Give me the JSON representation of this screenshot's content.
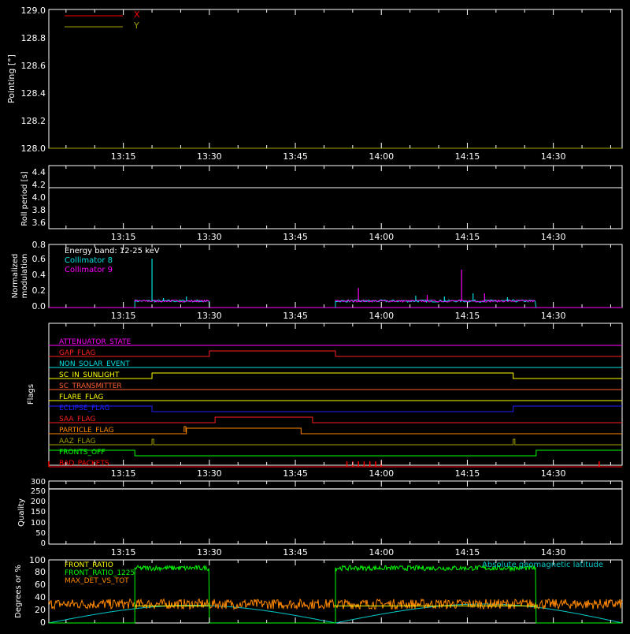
{
  "time_ticks": [
    "13:15",
    "13:30",
    "13:45",
    "14:00",
    "14:15",
    "14:30"
  ],
  "colors": {
    "background": "#000000",
    "axis": "#ffffff",
    "x_pointing": "#ff0000",
    "y_pointing": "#a0a000",
    "coll8": "#00e0e0",
    "coll9": "#ff00ff",
    "front_ratio": "#ffff00",
    "front_ratio_1225": "#00ff00",
    "max_det": "#ff8800",
    "geomag": "#00c8c8"
  },
  "pointing": {
    "ylabel": "Pointing [°]",
    "yticks": [
      "128.0",
      "128.2",
      "128.4",
      "128.6",
      "128.8",
      "129.0"
    ],
    "ylim": [
      128.0,
      129.0
    ],
    "legend": [
      {
        "label": "X",
        "color": "#ff0000"
      },
      {
        "label": "Y",
        "color": "#a0a000"
      }
    ]
  },
  "roll": {
    "ylabel": "Roll period [s]",
    "yticks": [
      "3.6",
      "3.8",
      "4.0",
      "4.2",
      "4.4"
    ],
    "ylim": [
      3.5,
      4.5
    ]
  },
  "modulation": {
    "ylabel1": "Normalized",
    "ylabel2": "modulation",
    "yticks": [
      "0.0",
      "0.2",
      "0.4",
      "0.6",
      "0.8"
    ],
    "ylim": [
      0.0,
      0.8
    ],
    "legend": [
      {
        "label": "Energy band: 12-25 keV",
        "color": "#ffffff"
      },
      {
        "label": "Collimator 8",
        "color": "#00e0e0"
      },
      {
        "label": "Collimator 9",
        "color": "#ff00ff"
      }
    ]
  },
  "flags": {
    "ylabel": "Flags",
    "items": [
      {
        "label": "ATTENUATOR_STATE",
        "color": "#ff00ff"
      },
      {
        "label": "GAP_FLAG",
        "color": "#ff2020"
      },
      {
        "label": "NON_SOLAR_EVENT",
        "color": "#00e0e0"
      },
      {
        "label": "SC_IN_SUNLIGHT",
        "color": "#ffff00"
      },
      {
        "label": "SC_TRANSMITTER",
        "color": "#ff6030"
      },
      {
        "label": "FLARE_FLAG",
        "color": "#ffff00"
      },
      {
        "label": "ECLIPSE_FLAG",
        "color": "#2020ff"
      },
      {
        "label": "SAA_FLAG",
        "color": "#ff2020"
      },
      {
        "label": "PARTICLE_FLAG",
        "color": "#ff8800"
      },
      {
        "label": "AAZ_FLAG",
        "color": "#a0a000"
      },
      {
        "label": "FRONTS_OFF",
        "color": "#00ff00"
      },
      {
        "label": "BAD_PACKETS",
        "color": "#ff0000"
      }
    ]
  },
  "quality": {
    "ylabel": "Quality",
    "yticks": [
      "0",
      "50",
      "100",
      "150",
      "200",
      "250",
      "300"
    ],
    "ylim": [
      0,
      300
    ]
  },
  "ratios": {
    "ylabel": "Degrees or %",
    "yticks": [
      "0",
      "20",
      "40",
      "60",
      "80",
      "100"
    ],
    "ylim": [
      0,
      100
    ],
    "legend": [
      {
        "label": "FRONT_RATIO",
        "color": "#ffff00"
      },
      {
        "label": "FRONT_RATIO_1225",
        "color": "#00ff00"
      },
      {
        "label": "MAX_DET_VS_TOT",
        "color": "#ff8800"
      }
    ],
    "geomag_label": "Absolute geomagnetic latitude"
  },
  "chart_data": [
    {
      "type": "line",
      "panel": "pointing",
      "ylabel": "Pointing [°]",
      "ylim": [
        128.0,
        129.0
      ],
      "series": [
        {
          "name": "X",
          "values": []
        },
        {
          "name": "Y",
          "values": []
        }
      ]
    },
    {
      "type": "line",
      "panel": "roll",
      "ylabel": "Roll period [s]",
      "ylim": [
        3.5,
        4.5
      ],
      "series": [
        {
          "name": "roll period",
          "x": [
            "13:02",
            "14:42"
          ],
          "values": [
            4.14,
            4.14
          ]
        }
      ]
    },
    {
      "type": "line",
      "panel": "modulation",
      "ylabel": "Normalized modulation",
      "ylim": [
        0.0,
        0.8
      ],
      "segments": [
        [
          "13:17",
          "13:30"
        ],
        [
          "13:52",
          "14:27"
        ]
      ],
      "baseline": 0.08,
      "series": [
        {
          "name": "Collimator 8",
          "spikes": [
            [
              "13:20",
              0.62
            ],
            [
              "13:22",
              0.12
            ],
            [
              "13:26",
              0.14
            ],
            [
              "14:06",
              0.15
            ],
            [
              "14:11",
              0.14
            ],
            [
              "14:16",
              0.18
            ],
            [
              "14:22",
              0.13
            ]
          ]
        },
        {
          "name": "Collimator 9",
          "spikes": [
            [
              "13:56",
              0.25
            ],
            [
              "14:08",
              0.16
            ],
            [
              "14:14",
              0.48
            ],
            [
              "14:18",
              0.18
            ]
          ]
        }
      ]
    },
    {
      "type": "step",
      "panel": "flags",
      "series": [
        {
          "name": "ATTENUATOR_STATE",
          "levels": [
            [
              "13:02",
              0
            ]
          ]
        },
        {
          "name": "GAP_FLAG",
          "levels": [
            [
              "13:02",
              0
            ],
            [
              "13:30",
              1
            ],
            [
              "13:52",
              0
            ]
          ]
        },
        {
          "name": "NON_SOLAR_EVENT",
          "levels": [
            [
              "13:02",
              0
            ]
          ]
        },
        {
          "name": "SC_IN_SUNLIGHT",
          "levels": [
            [
              "13:02",
              0
            ],
            [
              "13:20",
              1
            ],
            [
              "14:23",
              0
            ]
          ]
        },
        {
          "name": "SC_TRANSMITTER",
          "levels": [
            [
              "13:02",
              0
            ]
          ]
        },
        {
          "name": "FLARE_FLAG",
          "levels": [
            [
              "13:02",
              0
            ]
          ]
        },
        {
          "name": "ECLIPSE_FLAG",
          "levels": [
            [
              "13:02",
              1
            ],
            [
              "13:20",
              0
            ],
            [
              "14:23",
              1
            ]
          ]
        },
        {
          "name": "SAA_FLAG",
          "levels": [
            [
              "13:02",
              0
            ],
            [
              "13:31",
              1
            ],
            [
              "13:48",
              0
            ]
          ]
        },
        {
          "name": "PARTICLE_FLAG",
          "levels": [
            [
              "13:02",
              0
            ],
            [
              "13:26",
              1
            ],
            [
              "13:46",
              0
            ]
          ]
        },
        {
          "name": "AAZ_FLAG",
          "levels": [
            [
              "13:02",
              0
            ],
            [
              "13:20",
              1
            ],
            [
              "13:20.3",
              0
            ],
            [
              "14:23",
              1
            ],
            [
              "14:23.3",
              0
            ]
          ]
        },
        {
          "name": "FRONTS_OFF",
          "levels": [
            [
              "13:02",
              1
            ],
            [
              "13:17",
              0
            ],
            [
              "14:27",
              1
            ]
          ]
        },
        {
          "name": "BAD_PACKETS",
          "events": [
            "13:02",
            "13:54",
            "13:55",
            "13:56",
            "13:57",
            "13:58",
            "13:59",
            "14:00",
            "14:38"
          ]
        }
      ]
    },
    {
      "type": "line",
      "panel": "quality",
      "ylabel": "Quality",
      "ylim": [
        0,
        300
      ],
      "series": [
        {
          "name": "quality",
          "x": [
            "13:02",
            "14:42"
          ],
          "values": [
            300,
            300
          ]
        }
      ]
    },
    {
      "type": "line",
      "panel": "ratios",
      "ylabel": "Degrees or %",
      "ylim": [
        0,
        100
      ],
      "series": [
        {
          "name": "FRONT_RATIO",
          "segments": [
            [
              "13:17",
              "13:30",
              27
            ],
            [
              "13:52",
              "14:27",
              27
            ]
          ]
        },
        {
          "name": "FRONT_RATIO_1225",
          "segments": [
            [
              "13:17",
              "13:30",
              87
            ],
            [
              "13:52",
              "14:27",
              87
            ]
          ],
          "off_value": 0
        },
        {
          "name": "MAX_DET_VS_TOT",
          "mean": 30,
          "noise": 8
        },
        {
          "name": "Absolute geomagnetic latitude",
          "x": [
            "13:02",
            "13:27",
            "13:52",
            "14:18",
            "14:42"
          ],
          "values": [
            0,
            28,
            0,
            30,
            0
          ]
        }
      ]
    }
  ]
}
